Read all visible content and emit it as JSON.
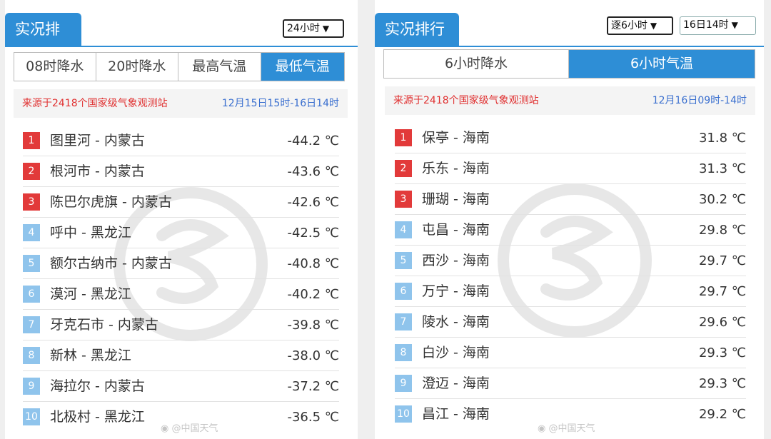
{
  "left": {
    "title": "实况排行",
    "select": "24小时",
    "tabs": [
      {
        "label": "08时降水",
        "active": false
      },
      {
        "label": "20时降水",
        "active": false
      },
      {
        "label": "最高气温",
        "active": false
      },
      {
        "label": "最低气温",
        "active": true
      }
    ],
    "source_text": "来源于2418个国家级气象观测站",
    "time_range": "12月15日15时-16日14时",
    "rows": [
      {
        "rank": "1",
        "name": "图里河 - 内蒙古",
        "value": "-44.2 ℃"
      },
      {
        "rank": "2",
        "name": "根河市 - 内蒙古",
        "value": "-43.6 ℃"
      },
      {
        "rank": "3",
        "name": "陈巴尔虎旗 - 内蒙古",
        "value": "-42.6 ℃"
      },
      {
        "rank": "4",
        "name": "呼中 - 黑龙江",
        "value": "-42.5 ℃"
      },
      {
        "rank": "5",
        "name": "额尔古纳市 - 内蒙古",
        "value": "-40.8 ℃"
      },
      {
        "rank": "6",
        "name": "漠河 - 黑龙江",
        "value": "-40.2 ℃"
      },
      {
        "rank": "7",
        "name": "牙克石市 - 内蒙古",
        "value": "-39.8 ℃"
      },
      {
        "rank": "8",
        "name": "新林 - 黑龙江",
        "value": "-38.0 ℃"
      },
      {
        "rank": "9",
        "name": "海拉尔 - 内蒙古",
        "value": "-37.2 ℃"
      },
      {
        "rank": "10",
        "name": "北极村 - 黑龙江",
        "value": "-36.5 ℃"
      }
    ]
  },
  "right": {
    "title": "实况排行",
    "select_interval": "逐6小时",
    "select_time": "16日14时",
    "tabs": [
      {
        "label": "6小时降水",
        "active": false
      },
      {
        "label": "6小时气温",
        "active": true
      }
    ],
    "source_text": "来源于2418个国家级气象观测站",
    "time_range": "12月16日09时-14时",
    "rows": [
      {
        "rank": "1",
        "name": "保亭 - 海南",
        "value": "31.8 ℃"
      },
      {
        "rank": "2",
        "name": "乐东 - 海南",
        "value": "31.3 ℃"
      },
      {
        "rank": "3",
        "name": "珊瑚 - 海南",
        "value": "30.2 ℃"
      },
      {
        "rank": "4",
        "name": "屯昌 - 海南",
        "value": "29.8 ℃"
      },
      {
        "rank": "5",
        "name": "西沙 - 海南",
        "value": "29.7 ℃"
      },
      {
        "rank": "6",
        "name": "万宁 - 海南",
        "value": "29.7 ℃"
      },
      {
        "rank": "7",
        "name": "陵水 - 海南",
        "value": "29.6 ℃"
      },
      {
        "rank": "8",
        "name": "白沙 - 海南",
        "value": "29.3 ℃"
      },
      {
        "rank": "9",
        "name": "澄迈 - 海南",
        "value": "29.3 ℃"
      },
      {
        "rank": "10",
        "name": "昌江 - 海南",
        "value": "29.2 ℃"
      }
    ]
  },
  "watermark_text": "@中国天气",
  "colors": {
    "accent": "#2e8ed6",
    "rank_top": "#e23a3a",
    "rank_rest": "#8fc4ec",
    "source_red": "#e03030",
    "source_blue": "#3a6fcf"
  },
  "icons": [
    "chevron-down-icon",
    "weather-logo-watermark-icon",
    "weibo-icon"
  ]
}
